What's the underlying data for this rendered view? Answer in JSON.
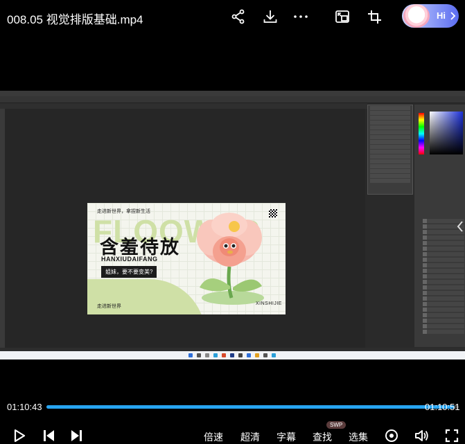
{
  "player": {
    "title": "008.05 视觉排版基础.mp4",
    "ai_assistant": {
      "label": "Hi"
    },
    "top_actions": [
      "share-icon",
      "download-icon",
      "more-icon",
      "picture-in-picture-icon",
      "rotate-icon"
    ],
    "time_current": "01:10:43",
    "time_total": "01:10:51",
    "progress": 0.99,
    "controls": {
      "speed": "倍速",
      "quality": "超清",
      "subtitle": "字幕",
      "search": "查找",
      "search_badge": "SWP",
      "episodes": "选集"
    },
    "colors": {
      "progress": "#27a4f1",
      "accent_ai": "#5b6cf0"
    }
  },
  "poster": {
    "bg_word": "FLOOWER",
    "tagline": "走进新世界，拿捏新生活",
    "title": "含羞待放",
    "pinyin": "HANXIUDAIFANG",
    "button": "姐妹，要不要变美?",
    "footer_left": "走进新世界",
    "footer_right": "XINSHIJIE",
    "colors": {
      "green": "#cfe0a6",
      "petal": "#f6b8ad"
    }
  }
}
